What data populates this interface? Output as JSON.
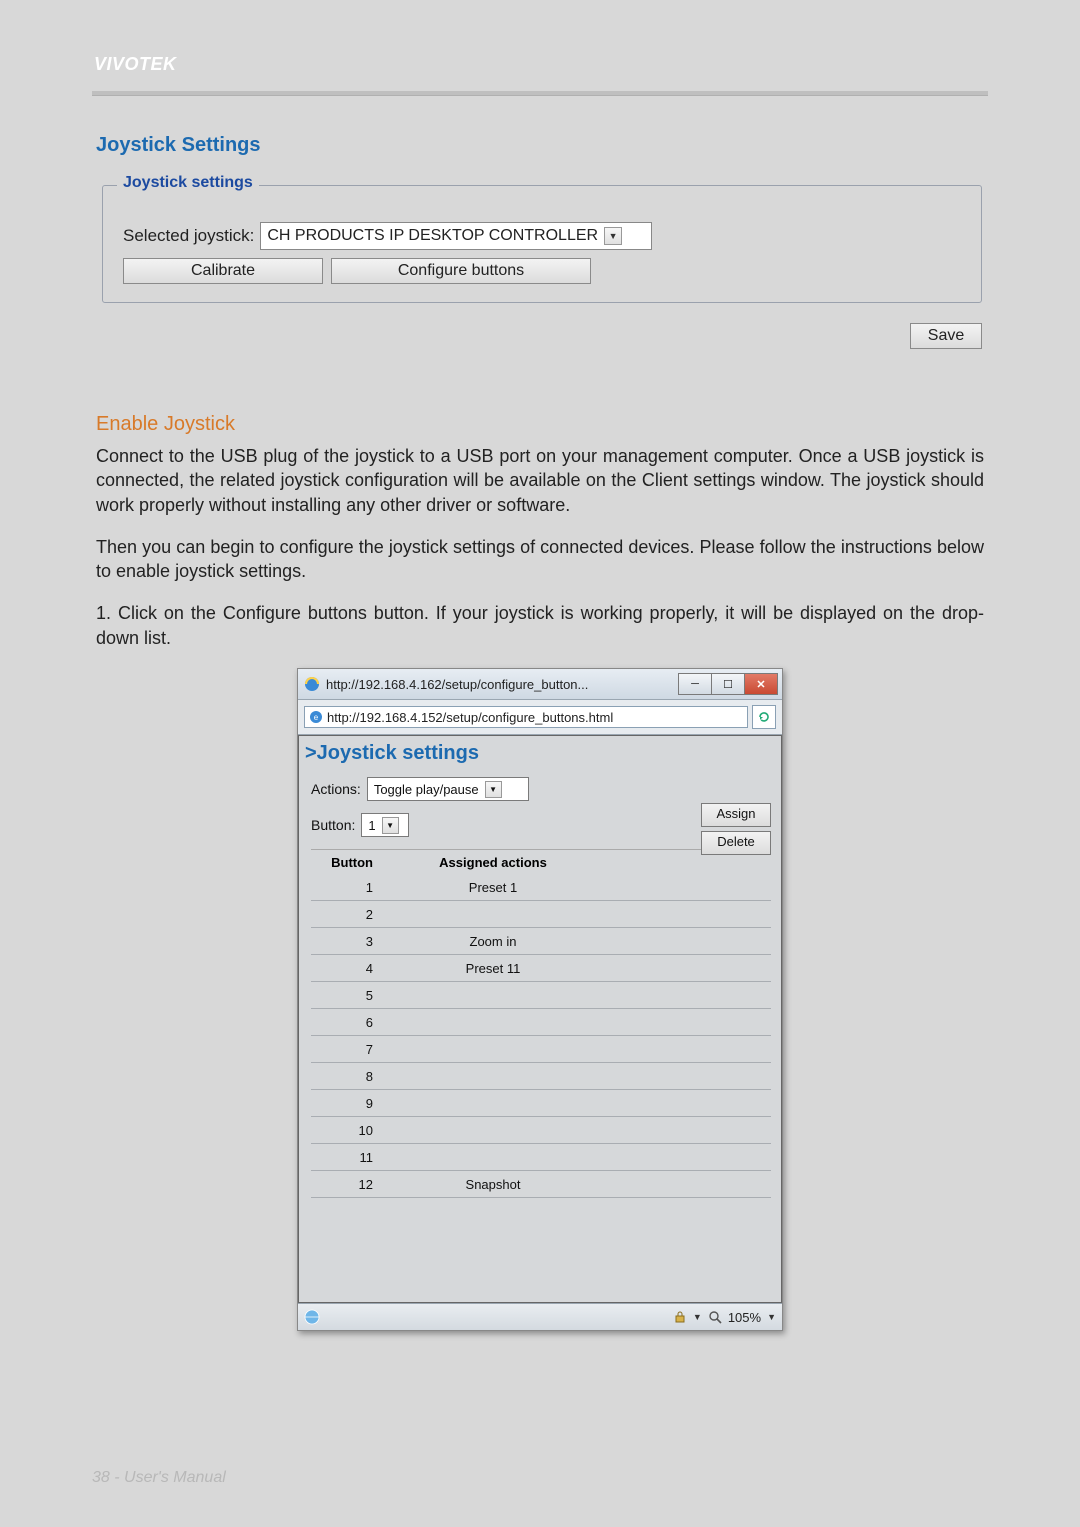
{
  "brand": "VIVOTEK",
  "section_title": "Joystick Settings",
  "fieldset": {
    "legend": "Joystick settings",
    "selected_label": "Selected joystick:",
    "selected_value": "CH PRODUCTS IP DESKTOP CONTROLLER",
    "calibrate_btn": "Calibrate",
    "configure_btn": "Configure buttons",
    "save_btn": "Save"
  },
  "enable": {
    "heading": "Enable Joystick",
    "p1": "Connect to the USB plug of the joystick to a USB port on your management computer. Once a USB joystick is connected, the related joystick configuration will be available on the Client settings window. The joystick should work properly without installing any other driver or software.",
    "p2": "Then you can begin to configure the joystick settings of connected devices. Please follow the instructions below to enable joystick settings.",
    "p3": "1. Click on the Configure buttons button. If your joystick is working properly, it will be displayed on the drop-down list."
  },
  "popup": {
    "title": "http://192.168.4.162/setup/configure_button...",
    "url": "http://192.168.4.152/setup/configure_buttons.html",
    "heading": ">Joystick settings",
    "actions_label": "Actions:",
    "actions_value": "Toggle play/pause",
    "button_label": "Button:",
    "button_value": "1",
    "assign_btn": "Assign",
    "delete_btn": "Delete",
    "table": {
      "col_button": "Button",
      "col_action": "Assigned actions",
      "rows": [
        {
          "n": "1",
          "a": "Preset 1"
        },
        {
          "n": "2",
          "a": ""
        },
        {
          "n": "3",
          "a": "Zoom in"
        },
        {
          "n": "4",
          "a": "Preset 11"
        },
        {
          "n": "5",
          "a": ""
        },
        {
          "n": "6",
          "a": ""
        },
        {
          "n": "7",
          "a": ""
        },
        {
          "n": "8",
          "a": ""
        },
        {
          "n": "9",
          "a": ""
        },
        {
          "n": "10",
          "a": ""
        },
        {
          "n": "11",
          "a": ""
        },
        {
          "n": "12",
          "a": "Snapshot"
        }
      ]
    },
    "status": {
      "zoom": "105%"
    }
  },
  "footer": "38 - User's Manual"
}
